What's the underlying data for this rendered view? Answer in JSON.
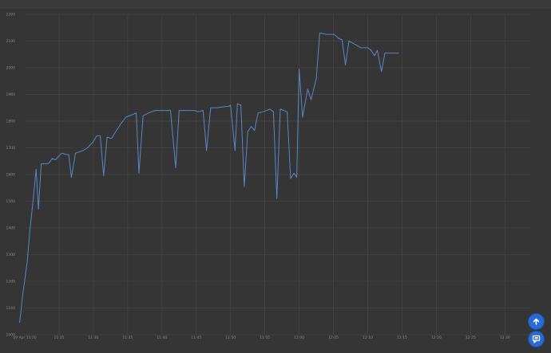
{
  "window": {
    "title": "",
    "right_text": ""
  },
  "chart_data": {
    "type": "line",
    "title": "",
    "xlabel": "",
    "ylabel": "",
    "ylim": [
      1000,
      2200
    ],
    "y_ticks": [
      1000,
      1100,
      1200,
      1300,
      1400,
      1500,
      1600,
      1700,
      1800,
      1900,
      2000,
      2100,
      2200
    ],
    "x_range": [
      0,
      140
    ],
    "x_ticks": [
      {
        "x": 0,
        "label": "09 Apr 11:20"
      },
      {
        "x": 10,
        "label": "11:25"
      },
      {
        "x": 20,
        "label": "11:30"
      },
      {
        "x": 30,
        "label": "11:35"
      },
      {
        "x": 40,
        "label": "11:40"
      },
      {
        "x": 50,
        "label": "11:45"
      },
      {
        "x": 60,
        "label": "11:50"
      },
      {
        "x": 70,
        "label": "11:55"
      },
      {
        "x": 80,
        "label": "12:00"
      },
      {
        "x": 90,
        "label": "12:05"
      },
      {
        "x": 100,
        "label": "12:10"
      },
      {
        "x": 110,
        "label": "12:15"
      },
      {
        "x": 120,
        "label": "12:20"
      },
      {
        "x": 130,
        "label": "12:25"
      },
      {
        "x": 140,
        "label": "12:30"
      }
    ],
    "grid": true,
    "series": [
      {
        "name": "",
        "color": "#5b86c4",
        "points": [
          [
            -1.5,
            1045
          ],
          [
            -0.5,
            1160
          ],
          [
            0.7,
            1270
          ],
          [
            1.5,
            1390
          ],
          [
            2.5,
            1510
          ],
          [
            3.3,
            1620
          ],
          [
            4.0,
            1470
          ],
          [
            4.8,
            1640
          ],
          [
            6.0,
            1640
          ],
          [
            7.0,
            1642
          ],
          [
            8.0,
            1660
          ],
          [
            9.0,
            1655
          ],
          [
            10.0,
            1670
          ],
          [
            10.8,
            1680
          ],
          [
            12.0,
            1675
          ],
          [
            12.8,
            1675
          ],
          [
            13.6,
            1590
          ],
          [
            14.8,
            1680
          ],
          [
            16.0,
            1685
          ],
          [
            17.0,
            1690
          ],
          [
            18.3,
            1700
          ],
          [
            19.8,
            1720
          ],
          [
            21.0,
            1745
          ],
          [
            22.0,
            1745
          ],
          [
            23.0,
            1595
          ],
          [
            24.0,
            1740
          ],
          [
            25.3,
            1735
          ],
          [
            26.5,
            1760
          ],
          [
            28.0,
            1790
          ],
          [
            29.5,
            1815
          ],
          [
            31.5,
            1825
          ],
          [
            32.5,
            1830
          ],
          [
            33.3,
            1605
          ],
          [
            34.5,
            1820
          ],
          [
            36.0,
            1830
          ],
          [
            38.0,
            1840
          ],
          [
            40.5,
            1840
          ],
          [
            42.5,
            1840
          ],
          [
            44.0,
            1625
          ],
          [
            45.0,
            1840
          ],
          [
            47.0,
            1840
          ],
          [
            49.5,
            1840
          ],
          [
            50.5,
            1835
          ],
          [
            52.0,
            1840
          ],
          [
            53.0,
            1690
          ],
          [
            54.2,
            1850
          ],
          [
            56.0,
            1850
          ],
          [
            58.5,
            1855
          ],
          [
            59.5,
            1855
          ],
          [
            60.0,
            1860
          ],
          [
            61.3,
            1690
          ],
          [
            62.0,
            1865
          ],
          [
            63.0,
            1860
          ],
          [
            64.0,
            1555
          ],
          [
            65.0,
            1760
          ],
          [
            66.0,
            1780
          ],
          [
            67.0,
            1765
          ],
          [
            68.0,
            1830
          ],
          [
            69.5,
            1835
          ],
          [
            71.5,
            1845
          ],
          [
            72.5,
            1835
          ],
          [
            73.5,
            1510
          ],
          [
            74.5,
            1845
          ],
          [
            76.5,
            1835
          ],
          [
            77.5,
            1585
          ],
          [
            78.5,
            1605
          ],
          [
            79.3,
            1590
          ],
          [
            80.0,
            1995
          ],
          [
            81.0,
            1815
          ],
          [
            82.5,
            1920
          ],
          [
            83.5,
            1880
          ],
          [
            85.0,
            1960
          ],
          [
            86.0,
            2130
          ],
          [
            88.0,
            2125
          ],
          [
            90.0,
            2125
          ],
          [
            90.7,
            2120
          ],
          [
            91.5,
            2110
          ],
          [
            92.5,
            2105
          ],
          [
            93.5,
            2010
          ],
          [
            94.5,
            2100
          ],
          [
            96.0,
            2090
          ],
          [
            98.0,
            2075
          ],
          [
            99.0,
            2075
          ],
          [
            100.0,
            2075
          ],
          [
            101.0,
            2065
          ],
          [
            102.0,
            2045
          ],
          [
            102.8,
            2065
          ],
          [
            104.0,
            1985
          ],
          [
            105.0,
            2055
          ],
          [
            106.5,
            2055
          ],
          [
            109.0,
            2055
          ]
        ]
      }
    ]
  },
  "buttons": {
    "scroll_top_icon": "arrow-up-icon",
    "chat_icon": "chat-flag-icon"
  }
}
